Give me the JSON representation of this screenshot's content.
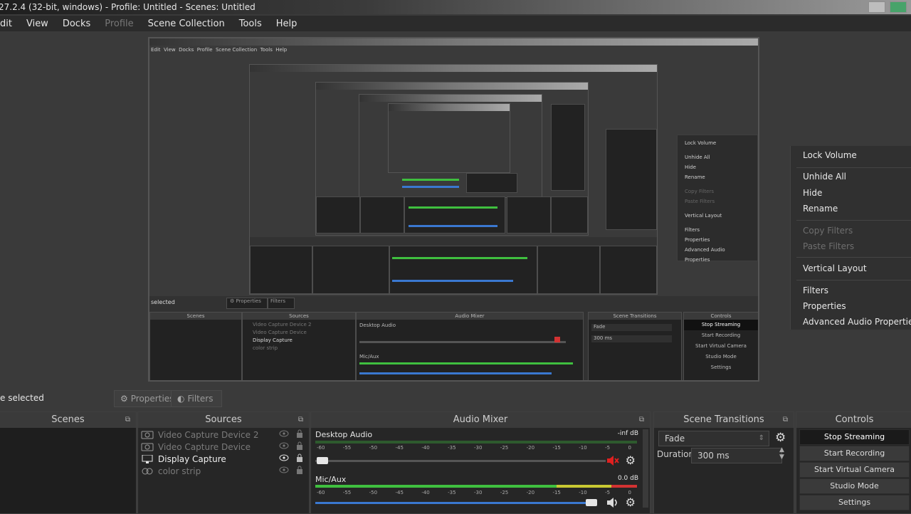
{
  "window": {
    "title": "27.2.4 (32-bit, windows) - Profile: Untitled - Scenes: Untitled"
  },
  "menu": [
    {
      "label": "Edit",
      "enabled": true
    },
    {
      "label": "View",
      "enabled": true
    },
    {
      "label": "Docks",
      "enabled": true
    },
    {
      "label": "Profile",
      "enabled": false
    },
    {
      "label": "Scene Collection",
      "enabled": true
    },
    {
      "label": "Tools",
      "enabled": true
    },
    {
      "label": "Help",
      "enabled": true
    }
  ],
  "menu_display": [
    "dit",
    "View",
    "Docks",
    "Profile",
    "Scene Collection",
    "Tools",
    "Help"
  ],
  "context_menu": {
    "items": [
      {
        "label": "Lock Volume",
        "enabled": true
      },
      {
        "label": "Unhide All",
        "enabled": true
      },
      {
        "label": "Hide",
        "enabled": true
      },
      {
        "label": "Rename",
        "enabled": true
      },
      {
        "label": "Copy Filters",
        "enabled": false
      },
      {
        "label": "Paste Filters",
        "enabled": false
      },
      {
        "label": "Vertical Layout",
        "enabled": true
      },
      {
        "label": "Filters",
        "enabled": true
      },
      {
        "label": "Properties",
        "enabled": true
      },
      {
        "label": "Advanced Audio Properties",
        "enabled": true
      }
    ]
  },
  "properties_bar": {
    "selection_text": "e selected",
    "properties_label": "Properties",
    "filters_label": "Filters"
  },
  "scenes_dock": {
    "title": "Scenes"
  },
  "sources_dock": {
    "title": "Sources",
    "items": [
      {
        "label": "Video Capture Device 2",
        "icon": "camera-icon",
        "visible": false
      },
      {
        "label": "Video Capture Device",
        "icon": "camera-icon",
        "visible": false
      },
      {
        "label": "Display Capture",
        "icon": "monitor-icon",
        "visible": true
      },
      {
        "label": "color strip",
        "icon": "link-icon",
        "visible": false
      }
    ]
  },
  "audio_mixer": {
    "title": "Audio Mixer",
    "channels": [
      {
        "name": "Desktop Audio",
        "db": "-inf dB",
        "muted": true
      },
      {
        "name": "Mic/Aux",
        "db": "0.0 dB",
        "muted": false
      }
    ],
    "ticks": [
      "-60",
      "-55",
      "-50",
      "-45",
      "-40",
      "-35",
      "-30",
      "-25",
      "-20",
      "-15",
      "-10",
      "-5",
      "0"
    ]
  },
  "scene_transitions": {
    "title": "Scene Transitions",
    "transition": "Fade",
    "duration_label": "Duration",
    "duration_value": "300 ms"
  },
  "controls": {
    "title": "Controls",
    "buttons": [
      "Stop Streaming",
      "Start Recording",
      "Start Virtual Camera",
      "Studio Mode",
      "Settings"
    ]
  },
  "preview_inner": {
    "selection_text": "selected",
    "docks": [
      "Scenes",
      "Sources",
      "Audio Mixer",
      "Scene Transitions",
      "Controls"
    ],
    "sources": [
      "Video Capture Device 2",
      "Video Capture Device",
      "Display Capture",
      "color strip"
    ],
    "channels": [
      "Desktop Audio",
      "Mic/Aux"
    ],
    "transition": "Fade",
    "duration": "300 ms",
    "controls": [
      "Stop Streaming",
      "Start Recording",
      "Start Virtual Camera",
      "Studio Mode",
      "Settings"
    ]
  },
  "colors": {
    "accent_blue": "#3a78d0",
    "meter_green": "#3fbf3f",
    "meter_yellow": "#c8c832",
    "meter_red": "#d23232",
    "mute_red": "#e02020"
  }
}
